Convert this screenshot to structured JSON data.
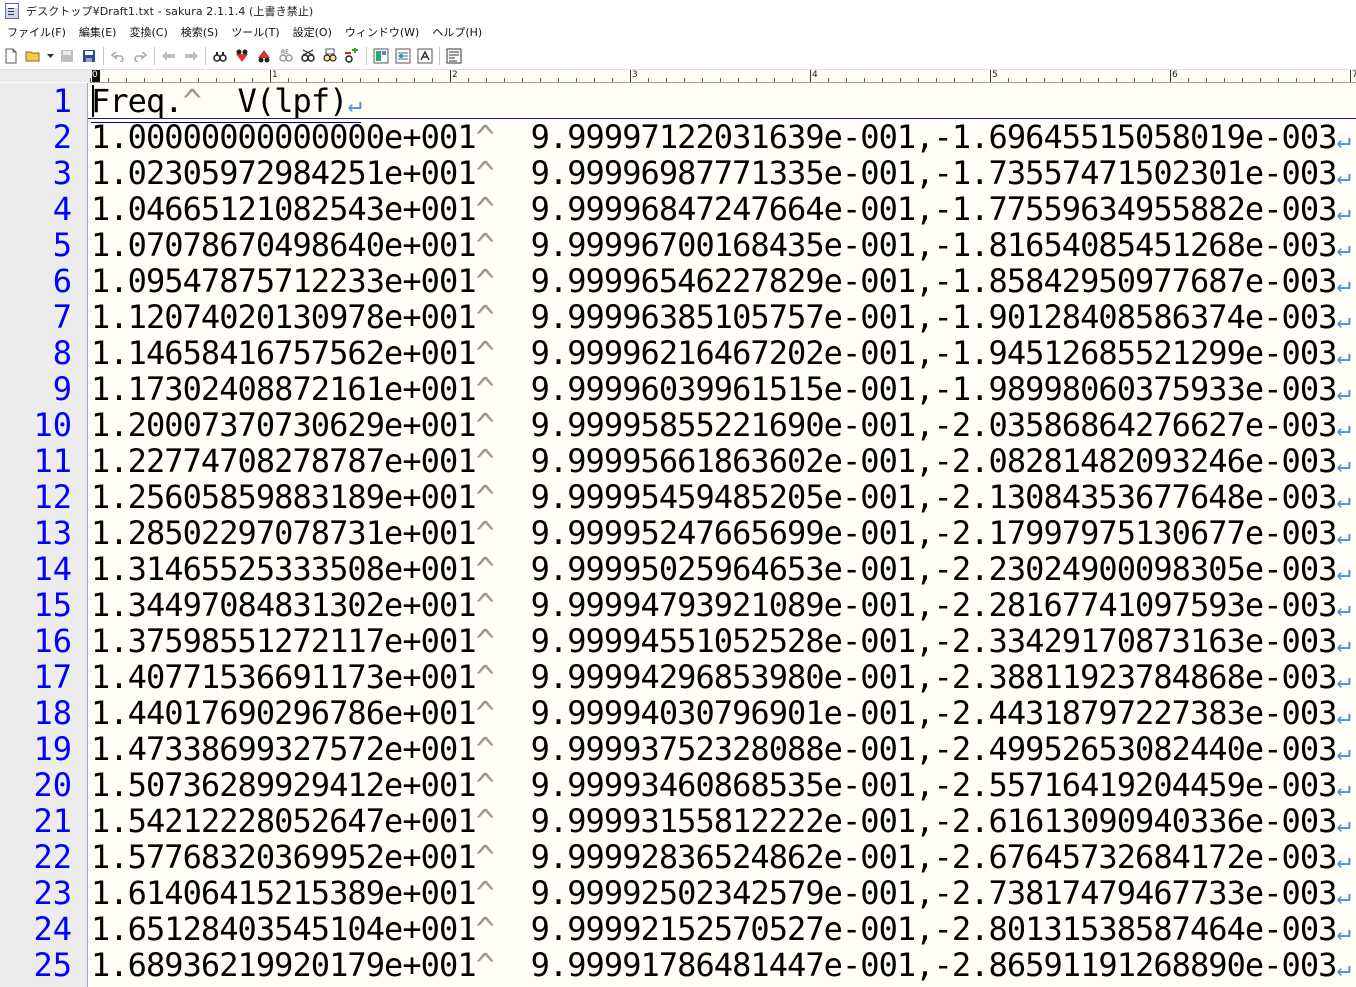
{
  "window": {
    "title": "デスクトップ¥Draft1.txt - sakura 2.1.1.4 (上書き禁止)"
  },
  "menu": [
    "ファイル(F)",
    "編集(E)",
    "変換(C)",
    "検索(S)",
    "ツール(T)",
    "設定(O)",
    "ウィンドウ(W)",
    "ヘルプ(H)"
  ],
  "toolbar": {
    "icons": [
      "new-file-icon",
      "open-folder-icon",
      "dropdown-arrow-icon",
      "save-disabled-icon",
      "save-icon",
      "undo-icon",
      "redo-icon",
      "jump-back-icon",
      "jump-forward-icon",
      "search-icon",
      "search-prev-icon",
      "search-next-icon",
      "bookmark-icon",
      "grep-icon",
      "replace-icon",
      "compare-icon",
      "outline-icon",
      "settings-icon",
      "font-icon",
      "window-list-icon"
    ]
  },
  "ruler": {
    "labels": [
      "0",
      "1",
      "2",
      "3",
      "4",
      "5",
      "6",
      "7"
    ]
  },
  "editor": {
    "tab_mark": "^",
    "eol_mark": "↵",
    "lines": [
      {
        "n": "1",
        "cols": [
          "Freq.",
          "V(lpf)"
        ]
      },
      {
        "n": "2",
        "cols": [
          "1.00000000000000e+001",
          "9.99997122031639e-001,-1.69645515058019e-003"
        ]
      },
      {
        "n": "3",
        "cols": [
          "1.02305972984251e+001",
          "9.99996987771335e-001,-1.73557471502301e-003"
        ]
      },
      {
        "n": "4",
        "cols": [
          "1.04665121082543e+001",
          "9.99996847247664e-001,-1.77559634955882e-003"
        ]
      },
      {
        "n": "5",
        "cols": [
          "1.07078670498640e+001",
          "9.99996700168435e-001,-1.81654085451268e-003"
        ]
      },
      {
        "n": "6",
        "cols": [
          "1.09547875712233e+001",
          "9.99996546227829e-001,-1.85842950977687e-003"
        ]
      },
      {
        "n": "7",
        "cols": [
          "1.12074020130978e+001",
          "9.99996385105757e-001,-1.90128408586374e-003"
        ]
      },
      {
        "n": "8",
        "cols": [
          "1.14658416757562e+001",
          "9.99996216467202e-001,-1.94512685521299e-003"
        ]
      },
      {
        "n": "9",
        "cols": [
          "1.17302408872161e+001",
          "9.99996039961515e-001,-1.98998060375933e-003"
        ]
      },
      {
        "n": "10",
        "cols": [
          "1.20007370730629e+001",
          "9.99995855221690e-001,-2.03586864276627e-003"
        ]
      },
      {
        "n": "11",
        "cols": [
          "1.22774708278787e+001",
          "9.99995661863602e-001,-2.08281482093246e-003"
        ]
      },
      {
        "n": "12",
        "cols": [
          "1.25605859883189e+001",
          "9.99995459485205e-001,-2.13084353677648e-003"
        ]
      },
      {
        "n": "13",
        "cols": [
          "1.28502297078731e+001",
          "9.99995247665699e-001,-2.17997975130677e-003"
        ]
      },
      {
        "n": "14",
        "cols": [
          "1.31465525333508e+001",
          "9.99995025964653e-001,-2.23024900098305e-003"
        ]
      },
      {
        "n": "15",
        "cols": [
          "1.34497084831302e+001",
          "9.99994793921089e-001,-2.28167741097593e-003"
        ]
      },
      {
        "n": "16",
        "cols": [
          "1.37598551272117e+001",
          "9.99994551052528e-001,-2.33429170873163e-003"
        ]
      },
      {
        "n": "17",
        "cols": [
          "1.40771536691173e+001",
          "9.99994296853980e-001,-2.38811923784868e-003"
        ]
      },
      {
        "n": "18",
        "cols": [
          "1.44017690296786e+001",
          "9.99994030796901e-001,-2.44318797227383e-003"
        ]
      },
      {
        "n": "19",
        "cols": [
          "1.47338699327572e+001",
          "9.99993752328088e-001,-2.49952653082440e-003"
        ]
      },
      {
        "n": "20",
        "cols": [
          "1.50736289929412e+001",
          "9.99993460868535e-001,-2.55716419204459e-003"
        ]
      },
      {
        "n": "21",
        "cols": [
          "1.54212228052647e+001",
          "9.99993155812222e-001,-2.61613090940336e-003"
        ]
      },
      {
        "n": "22",
        "cols": [
          "1.57768320369952e+001",
          "9.99992836524862e-001,-2.67645732684172e-003"
        ]
      },
      {
        "n": "23",
        "cols": [
          "1.61406415215389e+001",
          "9.99992502342579e-001,-2.73817479467733e-003"
        ]
      },
      {
        "n": "24",
        "cols": [
          "1.65128403545104e+001",
          "9.99992152570527e-001,-2.80131538587464e-003"
        ]
      },
      {
        "n": "25",
        "cols": [
          "1.68936219920179e+001",
          "9.99991786481447e-001,-2.86591191268890e-003"
        ]
      }
    ]
  }
}
